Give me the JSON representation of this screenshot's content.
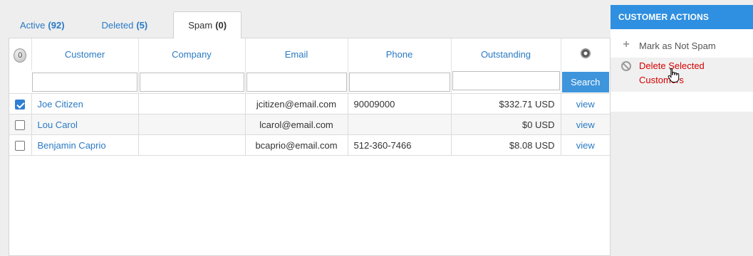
{
  "tabs": [
    {
      "label": "Active",
      "count": "(92)"
    },
    {
      "label": "Deleted",
      "count": "(5)"
    },
    {
      "label": "Spam",
      "count": "(0)"
    }
  ],
  "grid": {
    "selected_count": "0",
    "columns": [
      "Customer",
      "Company",
      "Email",
      "Phone",
      "Outstanding"
    ],
    "search_label": "Search",
    "rows": [
      {
        "checked": true,
        "customer": "Joe Citizen",
        "company": "",
        "email": "jcitizen@email.com",
        "phone": "90009000",
        "outstanding": "$332.71 USD",
        "action": "view"
      },
      {
        "checked": false,
        "customer": "Lou Carol",
        "company": "",
        "email": "lcarol@email.com",
        "phone": "",
        "outstanding": "$0 USD",
        "action": "view"
      },
      {
        "checked": false,
        "customer": "Benjamin Caprio",
        "company": "",
        "email": "bcaprio@email.com",
        "phone": "512-360-7466",
        "outstanding": "$8.08 USD",
        "action": "view"
      }
    ]
  },
  "sidebar": {
    "title": "CUSTOMER ACTIONS",
    "items": [
      {
        "label": "Mark as Not Spam",
        "icon": "plus-icon"
      },
      {
        "label": "Delete Selected Customers",
        "icon": "ban-icon"
      }
    ]
  },
  "colors": {
    "accent": "#2f8fe0",
    "link": "#2a7ac4",
    "danger": "#d40000"
  }
}
